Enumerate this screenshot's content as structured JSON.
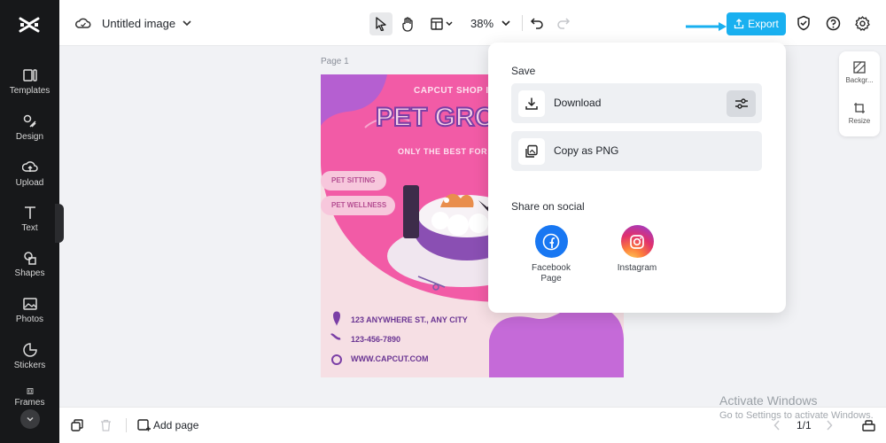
{
  "sidebar": {
    "items": [
      {
        "label": "Templates",
        "icon": "templates-icon"
      },
      {
        "label": "Design",
        "icon": "design-icon"
      },
      {
        "label": "Upload",
        "icon": "upload-icon"
      },
      {
        "label": "Text",
        "icon": "text-icon"
      },
      {
        "label": "Shapes",
        "icon": "shapes-icon"
      },
      {
        "label": "Photos",
        "icon": "photos-icon"
      },
      {
        "label": "Stickers",
        "icon": "stickers-icon"
      },
      {
        "label": "Frames",
        "icon": "frames-icon"
      }
    ]
  },
  "topbar": {
    "title": "Untitled image",
    "zoom": "38%",
    "export_label": "Export"
  },
  "canvas": {
    "page_label": "Page 1"
  },
  "poster": {
    "brand": "CAPCUT SHOP I",
    "headline": "PET GROO",
    "tagline": "ONLY THE BEST FOR",
    "tag1": "PET SITTING",
    "tag2": "PET WELLNESS",
    "address": "123 ANYWHERE ST., ANY CITY",
    "phone": "123-456-7890",
    "web": "WWW.CAPCUT.COM"
  },
  "right_panel": {
    "background_label": "Backgr...",
    "resize_label": "Resize"
  },
  "bottom_bar": {
    "add_page_label": "Add page",
    "pager": "1/1"
  },
  "dropdown": {
    "save_heading": "Save",
    "download_label": "Download",
    "copy_label": "Copy as PNG",
    "share_heading": "Share on social",
    "facebook_label": "Facebook Page",
    "instagram_label": "Instagram"
  },
  "watermark": {
    "line1": "Activate Windows",
    "line2": "Go to Settings to activate Windows."
  },
  "colors": {
    "accent": "#19b0f0",
    "poster_pink": "#f25ba6",
    "poster_purple": "#b55fd1"
  }
}
